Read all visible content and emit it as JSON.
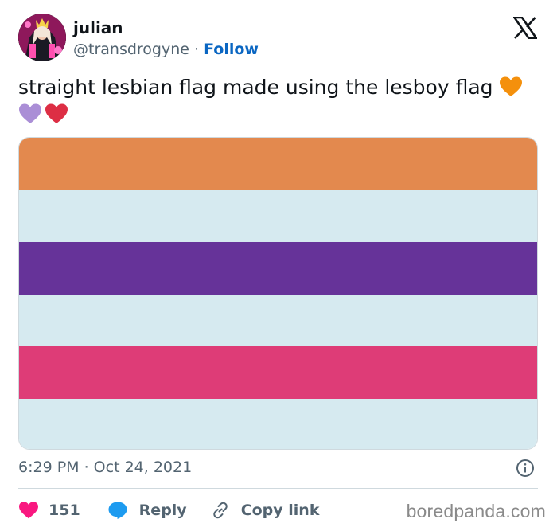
{
  "tweet": {
    "author_name": "julian",
    "handle": "@transdrogyne",
    "separator": " · ",
    "follow_label": "Follow",
    "text": "straight lesbian flag made using the lesboy flag ",
    "emoji": [
      "orange-heart",
      "purple-heart",
      "red-heart"
    ],
    "timestamp": "6:29 PM · Oct 24, 2021",
    "like_count": "151",
    "reply_label": "Reply",
    "copy_link_label": "Copy link"
  },
  "flag": {
    "stripes": [
      "#e3894e",
      "#d6eaf0",
      "#663399",
      "#d6eaf0",
      "#de3c77",
      "#d6eaf0"
    ]
  },
  "colors": {
    "text": "#0f1419",
    "secondary": "#536471",
    "follow": "#0a66c2",
    "like": "#f91880",
    "reply": "#1d9bf0",
    "orange_heart": "#f4900c",
    "purple_heart": "#aa8ed6",
    "red_heart": "#dd2e44"
  },
  "watermark": "boredpanda.com"
}
